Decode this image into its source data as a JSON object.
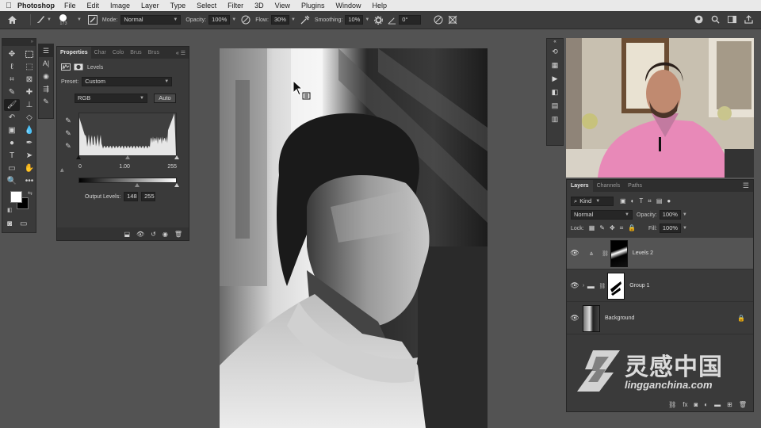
{
  "menubar": {
    "app": "Photoshop",
    "items": [
      "File",
      "Edit",
      "Image",
      "Layer",
      "Type",
      "Select",
      "Filter",
      "3D",
      "View",
      "Plugins",
      "Window",
      "Help"
    ]
  },
  "optbar": {
    "brush_size": "173",
    "mode_label": "Mode:",
    "mode_value": "Normal",
    "opacity_label": "Opacity:",
    "opacity_value": "100%",
    "flow_label": "Flow:",
    "flow_value": "30%",
    "smoothing_label": "Smoothing:",
    "smoothing_value": "10%",
    "angle_value": "0°"
  },
  "properties": {
    "tabs": [
      "Properties",
      "Char",
      "Colo",
      "Brus",
      "Brus"
    ],
    "adjustment_label": "Levels",
    "preset_label": "Preset:",
    "preset_value": "Custom",
    "channel_value": "RGB",
    "auto_label": "Auto",
    "input_black": "0",
    "input_gamma": "1.00",
    "input_white": "255",
    "output_label": "Output Levels:",
    "output_black": "148",
    "output_white": "255",
    "input_levels": {
      "black": 0,
      "gamma_position": 0.5,
      "white": 255
    },
    "output_levels": {
      "black": 148,
      "white": 255
    }
  },
  "layers_panel": {
    "tabs": [
      "Layers",
      "Channels",
      "Paths"
    ],
    "filter_label": "Kind",
    "blend_mode": "Normal",
    "opacity_label": "Opacity:",
    "opacity_value": "100%",
    "lock_label": "Lock:",
    "fill_label": "Fill:",
    "fill_value": "100%",
    "layers": [
      {
        "name": "Levels 2",
        "selected": true
      },
      {
        "name": "Group 1",
        "selected": false
      },
      {
        "name": "Background",
        "selected": false
      }
    ]
  },
  "watermark": {
    "chinese": "灵感中国",
    "url": "lingganchina.com"
  },
  "colors": {
    "foreground": "#ffffff",
    "background": "#000000",
    "selected_layer_bg": "#545454"
  }
}
